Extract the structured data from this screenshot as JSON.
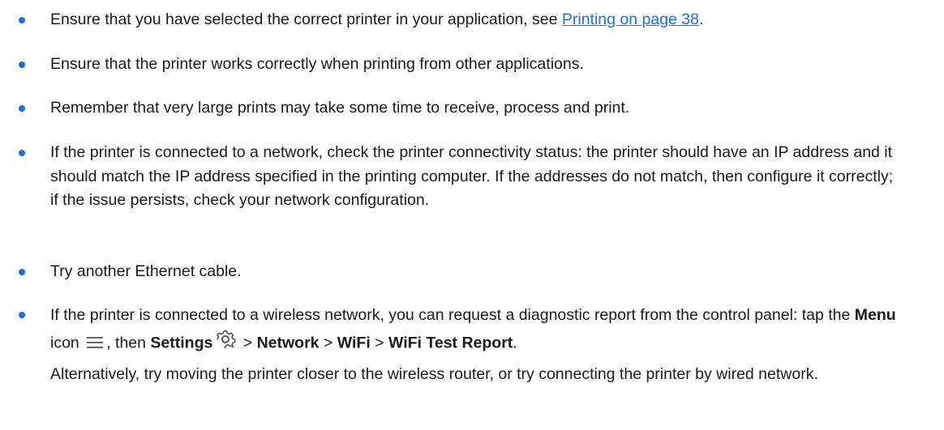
{
  "items": [
    {
      "text_before": "Ensure that you have selected the correct printer in your application, see ",
      "link": "Printing on page 38",
      "text_after": "."
    },
    {
      "text": "Ensure that the printer works correctly when printing from other applications."
    },
    {
      "text": "Remember that very large prints may take some time to receive, process and print."
    },
    {
      "text": "If the printer is connected to a network, check the printer connectivity status: the printer should have an IP address and it should match the IP address specified in the printing computer. If the addresses do not match, then configure it correctly; if the issue persists, check your network configuration."
    },
    {
      "text": "Try another Ethernet cable."
    },
    {
      "t1": "If the printer is connected to a wireless network, you can request a diagnostic report from the control panel: tap the ",
      "menu": "Menu",
      "t2": " icon ",
      "t3": ", then ",
      "settings": "Settings",
      "sep1": " > ",
      "network": "Network",
      "sep2": " > ",
      "wifi": "WiFi",
      "sep3": " > ",
      "report": "WiFi Test Report",
      "end": ".",
      "para2": "Alternatively, try moving the printer closer to the wireless router, or try connecting the printer by wired network."
    }
  ],
  "icons": {
    "menu": "menu-hamburger-icon",
    "settings": "settings-gear-icon"
  },
  "colors": {
    "bullet": "#1f6fd6",
    "link": "#1f6fd6",
    "text": "#1a1a1a"
  }
}
